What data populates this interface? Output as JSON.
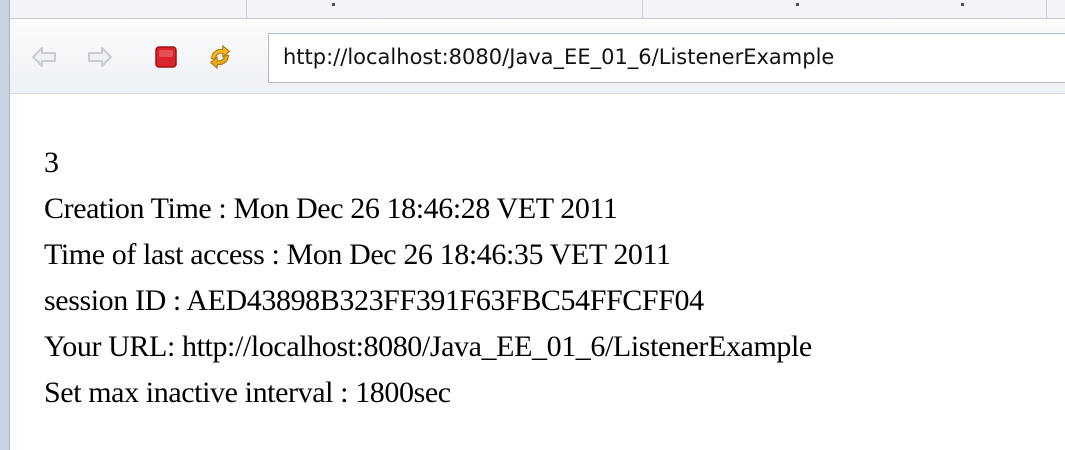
{
  "browser": {
    "back_icon": "back-arrow-icon",
    "forward_icon": "forward-arrow-icon",
    "stop_icon": "stop-icon",
    "refresh_icon": "refresh-icon",
    "url": "http://localhost:8080/Java_EE_01_6/ListenerExample",
    "colors": {
      "stop": "#d9252b",
      "refresh": "#e8a91a",
      "nav_disabled": "#c8cdd3"
    }
  },
  "page": {
    "lines": [
      "3",
      "Creation Time : Mon Dec 26 18:46:28 VET 2011",
      "Time of last access : Mon Dec 26 18:46:35 VET 2011",
      "session ID : AED43898B323FF391F63FBC54FFCFF04",
      "Your URL: http://localhost:8080/Java_EE_01_6/ListenerExample",
      "Set max inactive interval : 1800sec"
    ]
  }
}
